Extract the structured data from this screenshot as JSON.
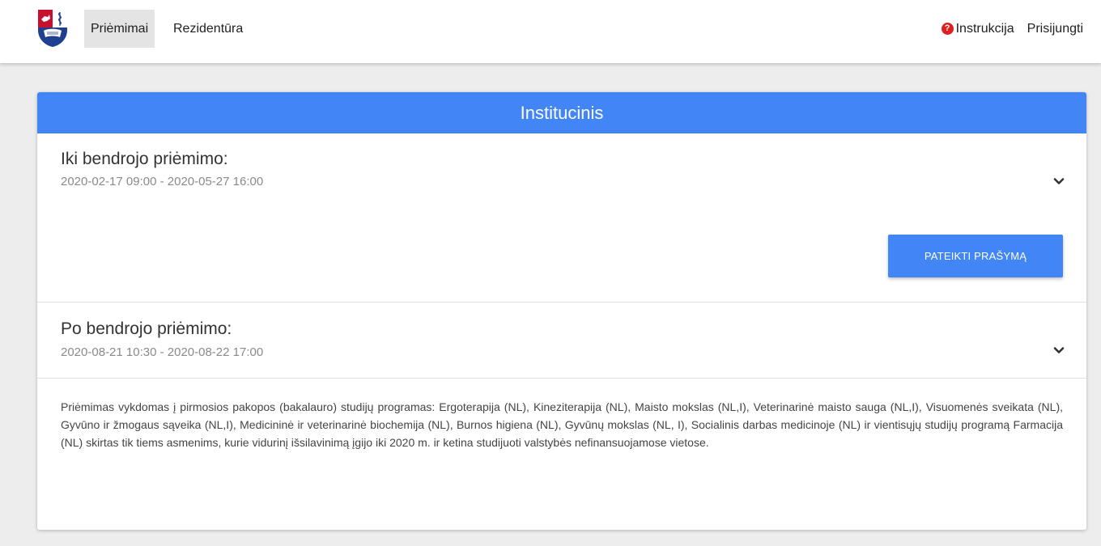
{
  "navbar": {
    "logo_icon": "university-crest-icon",
    "items": [
      {
        "label": "Priėmimai",
        "active": true
      },
      {
        "label": "Rezidentūra",
        "active": false
      }
    ],
    "help_icon": "question-circle-icon",
    "help_label": "Instrukcija",
    "login_label": "Prisijungti"
  },
  "card": {
    "title": "Institucinis",
    "accent_color": "#4285f4",
    "sections": [
      {
        "title": "Iki bendrojo priėmimo:",
        "dates": "2020-02-17 09:00 - 2020-05-27 16:00",
        "expand_icon": "chevron-down-icon",
        "button_label": "PATEIKTI PRAŠYMĄ"
      },
      {
        "title": "Po bendrojo priėmimo:",
        "dates": "2020-08-21 10:30 - 2020-08-22 17:00",
        "expand_icon": "chevron-down-icon"
      }
    ],
    "info_text": "Priėmimas vykdomas į pirmosios pakopos (bakalauro) studijų programas: Ergoterapija (NL), Kineziterapija (NL), Maisto mokslas (NL,I), Veterinarinė maisto sauga (NL,I), Visuomenės sveikata (NL), Gyvūno ir žmogaus sąveika (NL,I), Medicininė ir veterinarinė biochemija (NL), Burnos higiena (NL), Gyvūnų mokslas (NL, I), Socialinis darbas medicinoje (NL) ir vientisųjų studijų programą Farmacija (NL) skirtas tik tiems asmenims, kurie vidurinį išsilavinimą įgijo iki 2020 m. ir ketina studijuoti valstybės nefinansuojamose vietose."
  }
}
